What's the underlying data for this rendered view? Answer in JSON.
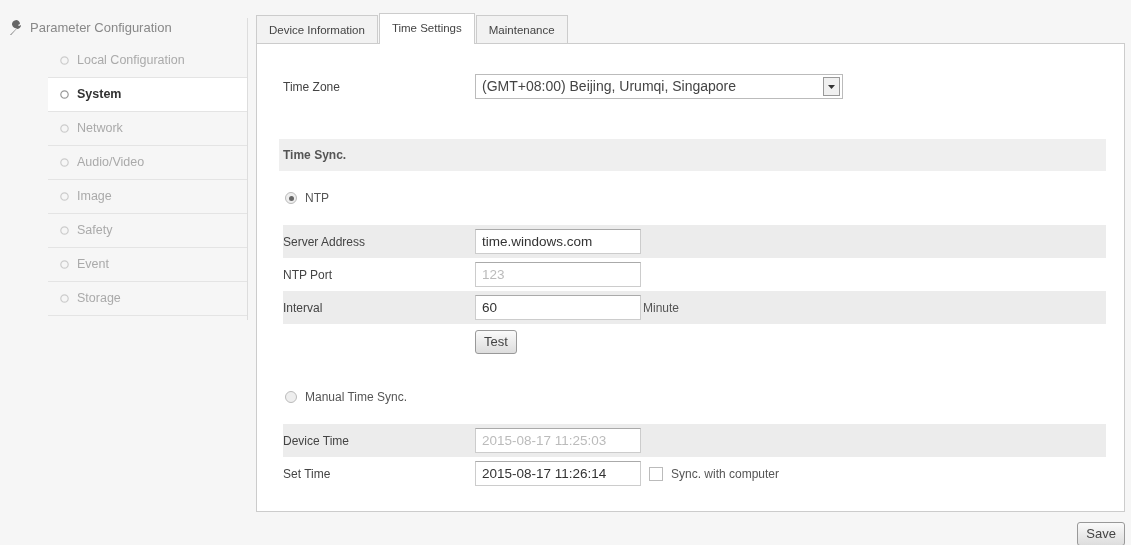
{
  "sidebar": {
    "title": "Parameter Configuration",
    "items": [
      {
        "label": "Local Configuration",
        "selected": false
      },
      {
        "label": "System",
        "selected": true
      },
      {
        "label": "Network",
        "selected": false
      },
      {
        "label": "Audio/Video",
        "selected": false
      },
      {
        "label": "Image",
        "selected": false
      },
      {
        "label": "Safety",
        "selected": false
      },
      {
        "label": "Event",
        "selected": false
      },
      {
        "label": "Storage",
        "selected": false
      }
    ]
  },
  "tabs": [
    {
      "label": "Device Information",
      "selected": false
    },
    {
      "label": "Time Settings",
      "selected": true
    },
    {
      "label": "Maintenance",
      "selected": false
    }
  ],
  "rows": [
    {
      "kind": "select",
      "label": "Time Zone",
      "value": "(GMT+08:00) Beijing, Urumqi, Singapore"
    },
    {
      "kind": "header",
      "label": "Time Sync."
    },
    {
      "kind": "radio",
      "label": "NTP",
      "selected": true
    },
    {
      "kind": "input",
      "label": "Server Address",
      "value": "time.windows.com",
      "disabled": false,
      "shaded": true
    },
    {
      "kind": "input",
      "label": "NTP Port",
      "value": "123",
      "disabled": true,
      "shaded": false
    },
    {
      "kind": "input",
      "label": "Interval",
      "value": "60",
      "unit": "Minute",
      "disabled": false,
      "shaded": true
    },
    {
      "kind": "button",
      "label": "Test"
    },
    {
      "kind": "radio",
      "label": "Manual Time Sync.",
      "selected": false
    },
    {
      "kind": "input",
      "label": "Device Time",
      "value": "2015-08-17 11:25:03",
      "disabled": true,
      "shaded": true
    },
    {
      "kind": "input",
      "label": "Set Time",
      "value": "2015-08-17 11:26:14",
      "disabled": false,
      "shaded": false,
      "checkbox": {
        "label": "Sync. with computer",
        "checked": false
      }
    }
  ],
  "save_button": "Save"
}
